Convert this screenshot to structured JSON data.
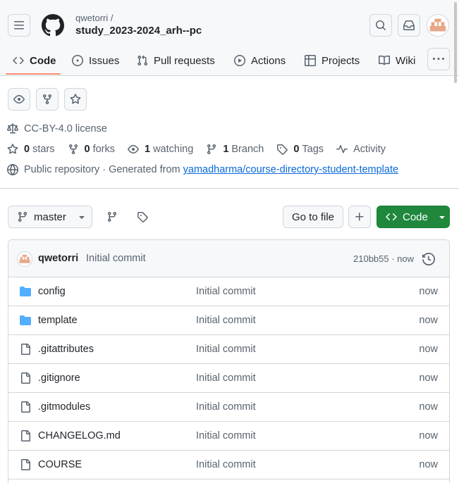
{
  "repo": {
    "owner": "qwetorri /",
    "name": "study_2023-2024_arh--pc"
  },
  "tabs": [
    {
      "label": "Code",
      "icon": "code-icon",
      "active": true
    },
    {
      "label": "Issues",
      "icon": "issue-icon",
      "active": false
    },
    {
      "label": "Pull requests",
      "icon": "pull-request-icon",
      "active": false
    },
    {
      "label": "Actions",
      "icon": "play-icon",
      "active": false
    },
    {
      "label": "Projects",
      "icon": "table-icon",
      "active": false
    },
    {
      "label": "Wiki",
      "icon": "book-icon",
      "active": false
    }
  ],
  "meta": {
    "license": "CC-BY-4.0 license",
    "stars_count": "0",
    "stars_label": "stars",
    "forks_count": "0",
    "forks_label": "forks",
    "watching_count": "1",
    "watching_label": "watching",
    "branch_count": "1",
    "branch_label": "Branch",
    "tags_count": "0",
    "tags_label": "Tags",
    "activity_label": "Activity",
    "visibility": "Public repository · Generated from",
    "template_link": "yamadharma/course-directory-student-template"
  },
  "toolbar": {
    "branch": "master",
    "go_to_file": "Go to file",
    "code_label": "Code"
  },
  "commit": {
    "author": "qwetorri",
    "message": "Initial commit",
    "hash_time": "210bb55 · now"
  },
  "files": [
    {
      "name": "config",
      "type": "folder",
      "message": "Initial commit",
      "time": "now"
    },
    {
      "name": "template",
      "type": "folder",
      "message": "Initial commit",
      "time": "now"
    },
    {
      "name": ".gitattributes",
      "type": "file",
      "message": "Initial commit",
      "time": "now"
    },
    {
      "name": ".gitignore",
      "type": "file",
      "message": "Initial commit",
      "time": "now"
    },
    {
      "name": ".gitmodules",
      "type": "file",
      "message": "Initial commit",
      "time": "now"
    },
    {
      "name": "CHANGELOG.md",
      "type": "file",
      "message": "Initial commit",
      "time": "now"
    },
    {
      "name": "COURSE",
      "type": "file",
      "message": "Initial commit",
      "time": "now"
    }
  ],
  "colors": {
    "accent_underline": "#fd8c73",
    "code_button": "#1f883d",
    "folder": "#54aeff",
    "link": "#0969da"
  }
}
